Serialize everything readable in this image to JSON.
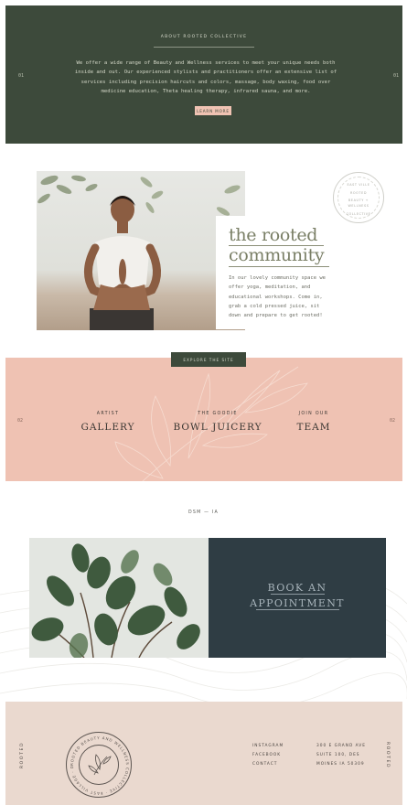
{
  "about": {
    "label": "ABOUT ROOTED COLLECTIVE",
    "copy": "We offer a wide range of Beauty and Wellness services to meet your unique needs both inside and out. Our experienced stylists and practitioners offer an extensive list of services including precision haircuts and colors, massage, body waxing, food over medicine education, Theta healing therapy, infrared sauna, and more.",
    "number_left": "01",
    "number_right": "01",
    "button": "LEARN MORE"
  },
  "community": {
    "title_line1": "the rooted",
    "title_line2": "community",
    "body": "In our lovely community space we offer yoga, meditation, and educational workshops. Come in, grab a cold pressed juice, sit down and prepare to get rooted!",
    "badge_lines": [
      "EAST VILLE",
      "ROOTED",
      "BEAUTY +",
      "WELLNESS",
      "COLLECTIVE"
    ]
  },
  "explore": {
    "button": "EXPLORE THE SITE"
  },
  "site_links": {
    "number_left": "02",
    "number_right": "02",
    "items": [
      {
        "small": "ARTIST",
        "big": "GALLERY"
      },
      {
        "small": "THE GOODIE",
        "big": "BOWL JUICERY"
      },
      {
        "small": "JOIN OUR",
        "big": "TEAM"
      }
    ]
  },
  "location": "DSM — IA",
  "booking": {
    "line1": "BOOK AN",
    "line2": "APPOINTMENT"
  },
  "footer": {
    "vertical_left": "ROOTED",
    "vertical_right": "ROOTED",
    "seal_text": "ROOTED BEAUTY AND WELLNESS COLLECTIVE · EAST VILLAGE · DSM · IA ·",
    "social": [
      "INSTAGRAM",
      "FACEBOOK",
      "CONTACT"
    ],
    "address": [
      "300 E GRAND AVE",
      "SUITE 100, DES",
      "MOINES IA 50309"
    ]
  },
  "colors": {
    "forest": "#3d4a3b",
    "blush": "#efc2b3",
    "navy": "#2f3d44",
    "sand": "#ead9cf"
  }
}
